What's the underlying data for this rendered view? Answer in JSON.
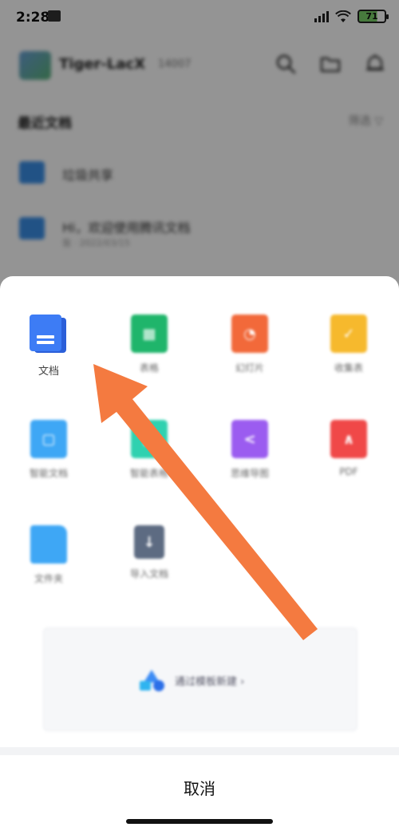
{
  "status_bar": {
    "time": "2:28",
    "battery_level": "71"
  },
  "header": {
    "user_name": "Tiger-LacX",
    "user_id": "14007"
  },
  "section": {
    "title": "最近文档",
    "filter_label": "筛选"
  },
  "files": [
    {
      "name": "垃圾共享",
      "meta": ""
    },
    {
      "name": "Hi，欢迎使用腾讯文档",
      "meta": "我 · 2022/03/15"
    }
  ],
  "create_menu": {
    "items": [
      {
        "label": "文档",
        "icon": "document-icon",
        "color": "#3d7cf5"
      },
      {
        "label": "表格",
        "icon": "sheet-icon",
        "color": "#1fb56b"
      },
      {
        "label": "幻灯片",
        "icon": "slides-icon",
        "color": "#f2693a"
      },
      {
        "label": "收集表",
        "icon": "form-icon",
        "color": "#f6b92d"
      },
      {
        "label": "智能文档",
        "icon": "smart-doc-icon",
        "color": "#3ea7f5"
      },
      {
        "label": "智能表格",
        "icon": "smart-sheet-icon",
        "color": "#2fd1b0"
      },
      {
        "label": "思维导图",
        "icon": "mindmap-icon",
        "color": "#9b5cf0"
      },
      {
        "label": "PDF",
        "icon": "pdf-icon",
        "color": "#f04848"
      },
      {
        "label": "文件夹",
        "icon": "folder-icon",
        "color": "#3ea7f5"
      },
      {
        "label": "导入文档",
        "icon": "import-icon",
        "color": "#5d6b82"
      }
    ],
    "template_label": "通过模板新建 ›",
    "cancel_label": "取消"
  },
  "colors": {
    "accent_arrow": "#f47a40",
    "doc_blue": "#3d7cf5"
  }
}
